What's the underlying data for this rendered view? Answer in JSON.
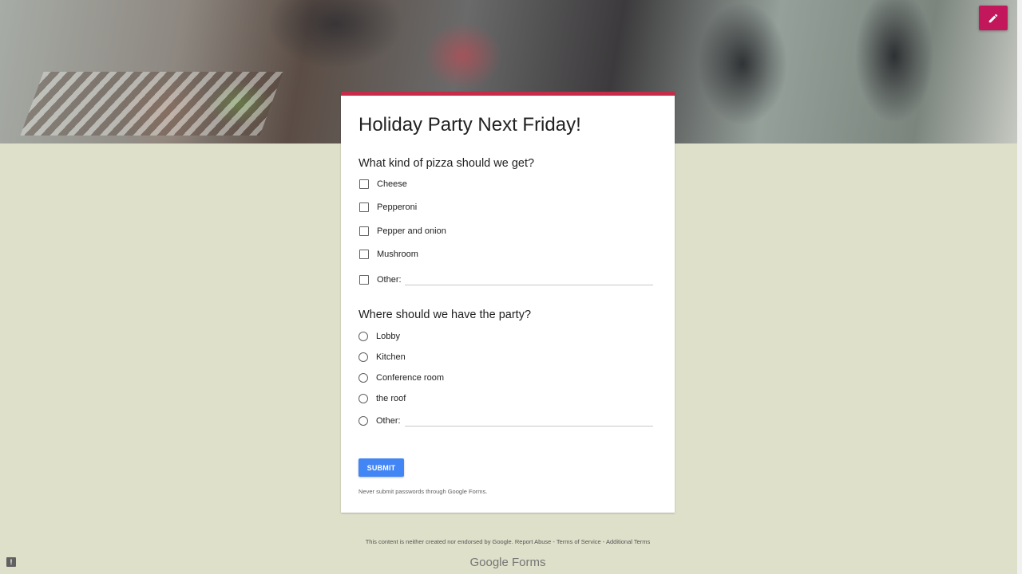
{
  "form": {
    "title": "Holiday Party Next Friday!",
    "question1": {
      "title": "What kind of pizza should we get?",
      "options": [
        "Cheese",
        "Pepperoni",
        "Pepper and onion",
        "Mushroom",
        "Other:"
      ]
    },
    "question2": {
      "title": "Where should we have the party?",
      "options": [
        "Lobby",
        "Kitchen",
        "Conference room",
        "the roof",
        "Other:"
      ]
    },
    "submit_label": "SUBMIT",
    "warning": "Never submit passwords through Google Forms."
  },
  "footer": {
    "disclaimer": "This content is neither created nor endorsed by Google. Report Abuse - Terms of Service - Additional Terms",
    "logo_google": "Google",
    "logo_forms": "Forms"
  },
  "icons": {
    "edit": "pencil-icon",
    "report": "report-icon"
  },
  "colors": {
    "accent": "#c62c49",
    "fab": "#c2185b",
    "submit": "#4285f4",
    "background": "#dfe0c9"
  }
}
